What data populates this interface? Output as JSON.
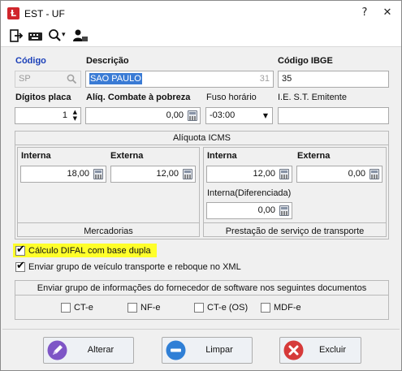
{
  "window": {
    "title": "EST - UF",
    "app_icon": "icon-letter"
  },
  "title_controls": {
    "help": "?",
    "close": "✕"
  },
  "toolbar": {
    "icons": [
      "exit-icon",
      "keyboard-icon",
      "search-icon",
      "user-icon"
    ],
    "search_arrow": "▾"
  },
  "fields": {
    "codigo": {
      "label": "Código",
      "value": "SP"
    },
    "descricao": {
      "label": "Descrição",
      "value": "SAO PAULO",
      "counter": "31"
    },
    "codigo_ibge": {
      "label": "Código IBGE",
      "value": "35"
    },
    "digitos_placa": {
      "label": "Dígitos placa",
      "value": "1"
    },
    "aliq_combate": {
      "label": "Alíq. Combate à pobreza",
      "value": "0,00"
    },
    "fuso_horario": {
      "label": "Fuso horário",
      "value": "-03:00"
    },
    "ie_st_emitente": {
      "label": "I.E. S.T.  Emitente",
      "value": ""
    }
  },
  "aliquota_icms": {
    "title": "Alíquota ICMS",
    "mercadorias": {
      "title": "Mercadorias",
      "interna_label": "Interna",
      "interna_value": "18,00",
      "externa_label": "Externa",
      "externa_value": "12,00"
    },
    "transporte": {
      "title": "Prestação de serviço de transporte",
      "interna_label": "Interna",
      "interna_value": "12,00",
      "externa_label": "Externa",
      "externa_value": "0,00",
      "diferenciada_label": "Interna(Diferenciada)",
      "diferenciada_value": "0,00"
    }
  },
  "options": {
    "difal_dupla": {
      "label": "Cálculo DIFAL com base dupla",
      "checked": true
    },
    "grupo_veiculo": {
      "label": "Enviar grupo de veículo transporte e reboque no XML",
      "checked": true
    }
  },
  "software_group": {
    "title": "Enviar grupo de informações do fornecedor de software nos seguintes documentos",
    "items": [
      {
        "label": "CT-e",
        "checked": false
      },
      {
        "label": "NF-e",
        "checked": false
      },
      {
        "label": "CT-e (OS)",
        "checked": false
      },
      {
        "label": "MDF-e",
        "checked": false
      }
    ]
  },
  "buttons": {
    "alterar": "Alterar",
    "limpar": "Limpar",
    "excluir": "Excluir"
  },
  "colors": {
    "required_label": "#1a3fb8",
    "highlight": "#ffff2a",
    "accent": "#3a7bd5"
  }
}
